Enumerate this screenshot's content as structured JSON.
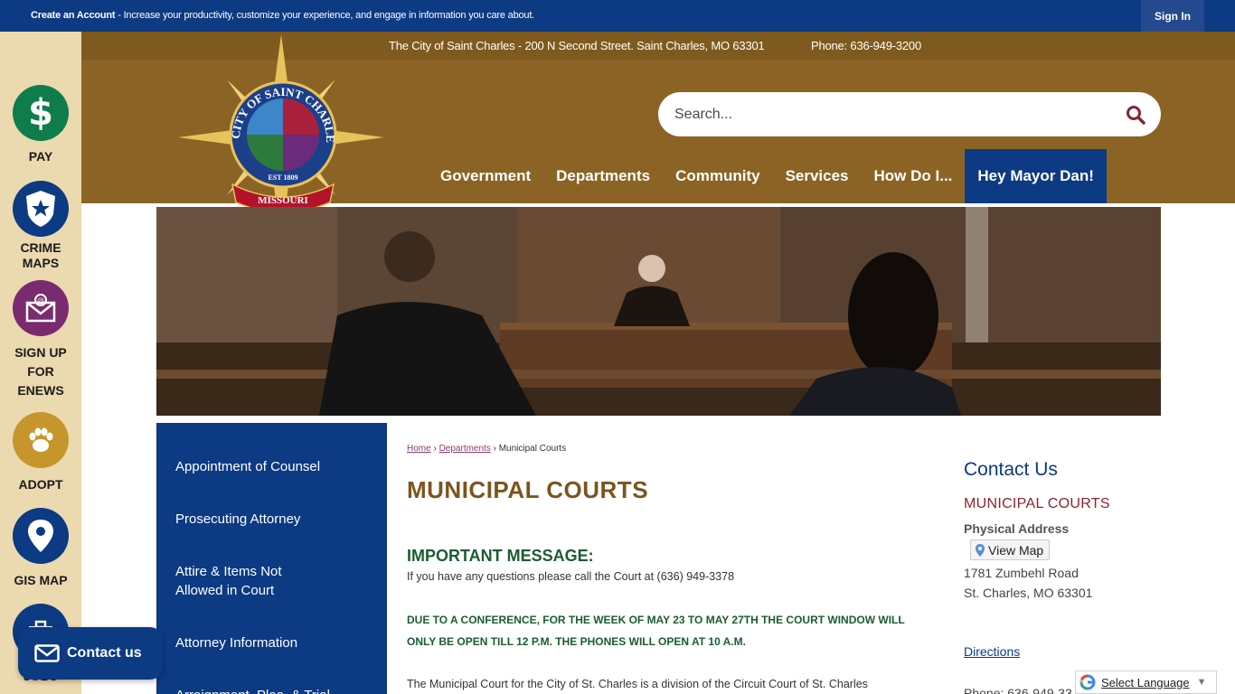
{
  "topbar": {
    "create_account": "Create an Account",
    "message": " - Increase your productivity, customize your experience, and engage in information you care about.",
    "sign_in": "Sign In"
  },
  "info": {
    "address": "The City of Saint Charles - 200 N Second Street. Saint Charles, MO 63301",
    "phone": "Phone: 636-949-3200"
  },
  "logo": {
    "ring_text": "CITY OF SAINT CHARLES",
    "est": "EST 1809",
    "banner": "MISSOURI"
  },
  "search": {
    "placeholder": "Search..."
  },
  "nav": {
    "items": [
      "Government",
      "Departments",
      "Community",
      "Services",
      "How Do I..."
    ],
    "highlight": "Hey Mayor Dan!"
  },
  "rail": {
    "pay": "PAY",
    "crime1": "CRIME",
    "crime2": "MAPS",
    "signup1": "SIGN UP",
    "signup2": "FOR",
    "signup3": "ENEWS",
    "adopt": "ADOPT",
    "gis": "GIS MAP",
    "jobs": "JOBS"
  },
  "sidenav": {
    "items": [
      "Appointment of Counsel",
      "Prosecuting Attorney",
      "Attire & Items Not Allowed in Court",
      "Attorney Information",
      "Arraignment, Plea, & Trial"
    ]
  },
  "breadcrumb": {
    "home": "Home",
    "departments": "Departments",
    "current": "Municipal Courts",
    "sep": " › "
  },
  "main": {
    "title": "MUNICIPAL COURTS",
    "important": "IMPORTANT MESSAGE:",
    "questions": "If you have any questions please call the Court at (636) 949-3378",
    "alert": "DUE TO A CONFERENCE, FOR THE WEEK OF MAY 23 TO MAY 27TH THE COURT WINDOW WILL ONLY BE OPEN TILL 12 P.M.   THE PHONES WILL OPEN AT 10 A.M.",
    "intro": "The Municipal Court for the City of St. Charles is a division of the Circuit Court of St. Charles"
  },
  "contact": {
    "heading": "Contact Us",
    "dept": "MUNICIPAL COURTS",
    "physical_label": "Physical Address",
    "view_map": "View Map",
    "street": "1781 Zumbehl Road",
    "city": "St. Charles, MO 63301",
    "directions": "Directions",
    "phone": "Phone: 636-949-33"
  },
  "contact_button": "Contact us",
  "translate": {
    "label": "Select Language",
    "arrow": "▼"
  },
  "colors": {
    "navy": "#0c3a83",
    "gold": "#8b6325",
    "rail": "#ebd9af",
    "pay": "#0f7c4b",
    "signup": "#7a2a6e",
    "adopt": "#c6962d"
  }
}
